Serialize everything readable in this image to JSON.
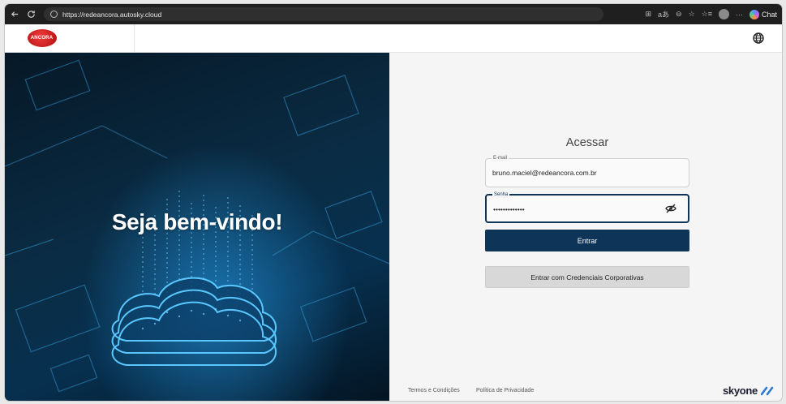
{
  "browser": {
    "url": "https://redeancora.autosky.cloud",
    "chat_label": "Chat"
  },
  "header": {
    "brand": "ANCORA"
  },
  "hero": {
    "welcome": "Seja bem-vindo!"
  },
  "login": {
    "title": "Acessar",
    "email_label": "E-mail",
    "email_value": "bruno.maciel@redeancora.com.br",
    "password_label": "Senha",
    "password_value": "•••••••••••••",
    "submit_label": "Entrar",
    "corporate_label": "Entrar com Credenciais Corporativas"
  },
  "footer": {
    "terms": "Termos e Condições",
    "privacy": "Política de Privacidade",
    "brand": "skyone"
  },
  "colors": {
    "primary": "#0e3457",
    "brand_red": "#d31d1d",
    "panel_bg": "#f5f5f5"
  },
  "icons": {
    "back": "arrow-left-icon",
    "reload": "reload-icon",
    "globe": "globe-icon",
    "eye": "eye-off-icon"
  }
}
